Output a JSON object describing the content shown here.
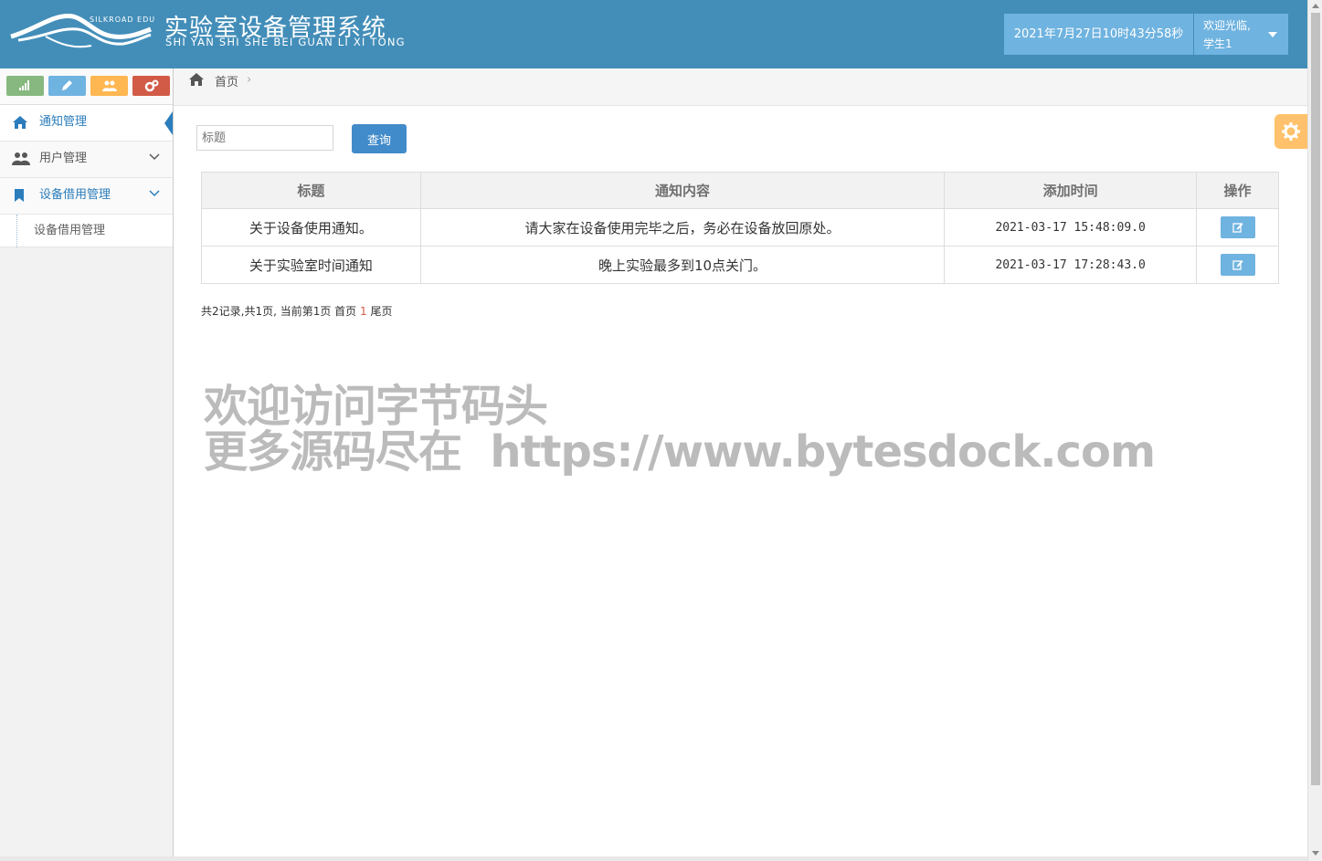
{
  "header": {
    "logo_text": "SILKROAD EDU",
    "title": "实验室设备管理系统",
    "subtitle": "SHI YAN SHI SHE BEI GUAN LI XI TONG",
    "clock": "2021年7月27日10时43分58秒",
    "welcome_line1": "欢迎光临,",
    "welcome_line2": "学生1"
  },
  "sidebar": {
    "shortcuts": [
      {
        "icon": "signal-icon",
        "color": "#87b87f"
      },
      {
        "icon": "pencil-icon",
        "color": "#6fb3e0"
      },
      {
        "icon": "users-icon",
        "color": "#ffb752"
      },
      {
        "icon": "cogs-icon",
        "color": "#d15b47"
      }
    ],
    "items": [
      {
        "label": "通知管理",
        "icon": "home-icon",
        "active": true
      },
      {
        "label": "用户管理",
        "icon": "users-icon"
      },
      {
        "label": "设备借用管理",
        "icon": "bookmark-icon",
        "open": true
      }
    ],
    "subitems": [
      {
        "label": "设备借用管理"
      }
    ]
  },
  "breadcrumb": {
    "home": "首页",
    "separator": "›"
  },
  "search": {
    "placeholder": "标题",
    "button": "查询"
  },
  "table": {
    "headers": [
      "标题",
      "通知内容",
      "添加时间",
      "操作"
    ],
    "rows": [
      {
        "title": "关于设备使用通知。",
        "content": "请大家在设备使用完毕之后，务必在设备放回原处。",
        "time": "2021-03-17 15:48:09.0"
      },
      {
        "title": "关于实验室时间通知",
        "content": "晚上实验最多到10点关门。",
        "time": "2021-03-17 17:28:43.0"
      }
    ]
  },
  "pager": {
    "summary": "共2记录,共1页, 当前第1页 首页 ",
    "current": "1",
    "last": " 尾页"
  },
  "watermark": {
    "line1": "欢迎访问字节码头",
    "line2": "更多源码尽在  https://www.bytesdock.com"
  },
  "colors": {
    "header_bg": "#438eb9",
    "accent": "#2b7dbc",
    "button": "#428bca",
    "settings": "#ffb752"
  }
}
